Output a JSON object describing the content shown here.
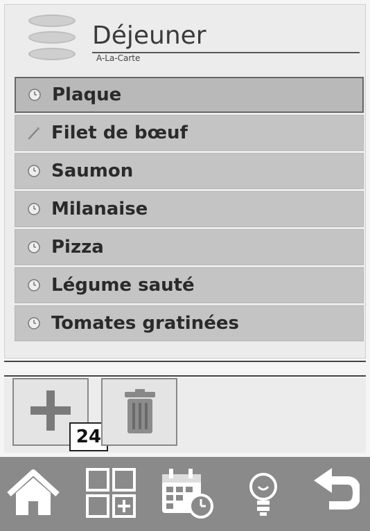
{
  "header": {
    "title": "Déjeuner",
    "subtitle": "A-La-Carte",
    "logo_icon": "stacked-plates-icon"
  },
  "menu": {
    "items": [
      {
        "label": "Plaque",
        "icon": "clock-icon",
        "selected": true
      },
      {
        "label": "Filet de bœuf",
        "icon": "thermometer-probe-icon",
        "selected": false
      },
      {
        "label": "Saumon",
        "icon": "clock-icon",
        "selected": false
      },
      {
        "label": "Milanaise",
        "icon": "clock-icon",
        "selected": false
      },
      {
        "label": "Pizza",
        "icon": "clock-icon",
        "selected": false
      },
      {
        "label": "Légume sauté",
        "icon": "clock-icon",
        "selected": false
      },
      {
        "label": "Tomates gratinées",
        "icon": "clock-icon",
        "selected": false
      }
    ]
  },
  "toolbar": {
    "add_icon": "plus-icon",
    "count": "24",
    "delete_icon": "trash-icon"
  },
  "bottom_nav": [
    {
      "icon": "home-icon"
    },
    {
      "icon": "grid-add-icon"
    },
    {
      "icon": "calendar-clock-icon"
    },
    {
      "icon": "lightbulb-icon"
    },
    {
      "icon": "back-arrow-icon"
    }
  ],
  "colors": {
    "item_bg": "#c4c4c4",
    "nav_bg": "#8a8a8a",
    "icon_white": "#ffffff"
  }
}
